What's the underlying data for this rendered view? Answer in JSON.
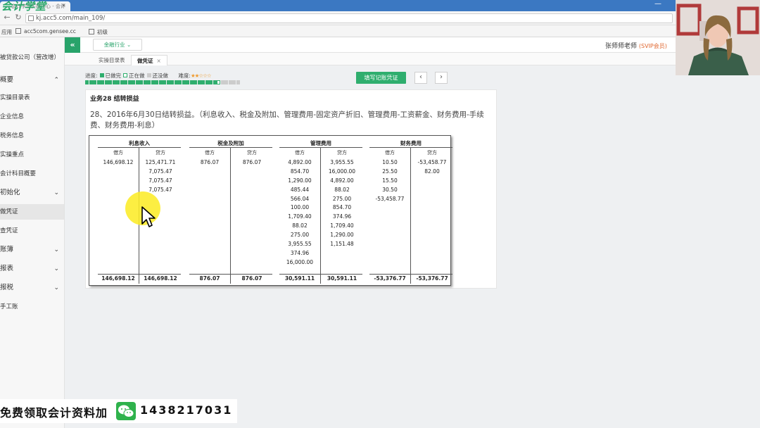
{
  "browser": {
    "tab_logo": "会计学堂",
    "tab_title": "会计学堂实操中心 - 会计",
    "tab_close": "×",
    "url": "kj.acc5.com/main_109/",
    "bookmarks": [
      "应用",
      "acc5com.gensee.cc",
      "初级"
    ]
  },
  "sidebar": {
    "company": "被贷款公司（营改增）",
    "items": [
      {
        "label": "概要",
        "group": true,
        "chevron": "⌃"
      },
      {
        "label": "实操目录表"
      },
      {
        "label": "企业信息"
      },
      {
        "label": "税务信息"
      },
      {
        "label": "实操重点"
      },
      {
        "label": "会计科目概要"
      },
      {
        "label": "初始化",
        "group": true,
        "chevron": "⌄"
      },
      {
        "label": "做凭证",
        "active": true
      },
      {
        "label": "查凭证"
      },
      {
        "label": "账簿",
        "group": true,
        "chevron": "⌄"
      },
      {
        "label": "报表",
        "group": true,
        "chevron": "⌄"
      },
      {
        "label": "报税",
        "group": true,
        "chevron": "⌄"
      },
      {
        "label": "手工账"
      }
    ]
  },
  "topbar": {
    "collapse_icon": "«",
    "industry": "金融行业 ⌄",
    "teacher": "张师师老师",
    "vip": "(SVIP会员)"
  },
  "tabs": [
    {
      "label": "实操目录表"
    },
    {
      "label": "做凭证",
      "close": "×"
    }
  ],
  "progress": {
    "label": "进度:",
    "done": "已做完",
    "doing": "正在做",
    "todo": "还没做",
    "difficulty_label": "难度:",
    "difficulty_stars": "★★☆☆☆",
    "done_color": "#2fae6e",
    "doing_color": "#ffffff",
    "todo_color": "#cccccc",
    "segments_done": 34,
    "segments_total": 40
  },
  "actions": {
    "fill_voucher": "填写记账凭证",
    "prev": "‹",
    "next": "›"
  },
  "business": {
    "title": "业务28 结转损益",
    "question": "28、2016年6月30日结转损益。（利息收入、税金及附加、管理费用-固定资产折旧、管理费用-工资薪金、财务费用-手续费、财务费用-利息）"
  },
  "t_accounts": [
    {
      "name": "利息收入",
      "debit_label": "借方",
      "credit_label": "贷方",
      "debits": [
        "146,698.12"
      ],
      "credits": [
        "125,471.71",
        "7,075.47",
        "7,075.47",
        "7,075.47"
      ],
      "debit_total": "146,698.12",
      "credit_total": "146,698.12"
    },
    {
      "name": "税金及附加",
      "debit_label": "借方",
      "credit_label": "贷方",
      "debits": [
        "876.07"
      ],
      "credits": [
        "876.07"
      ],
      "debit_total": "876.07",
      "credit_total": "876.07"
    },
    {
      "name": "管理费用",
      "debit_label": "借方",
      "credit_label": "贷方",
      "debits": [
        "4,892.00",
        "854.70",
        "1,290.00",
        "485.44",
        "566.04",
        "100.00",
        "1,709.40",
        "88.02",
        "275.00",
        "3,955.55",
        "374.96",
        "16,000.00"
      ],
      "credits": [
        "3,955.55",
        "16,000.00",
        "4,892.00",
        "88.02",
        "275.00",
        "854.70",
        "374.96",
        "1,709.40",
        "1,290.00",
        "1,151.48"
      ],
      "debit_total": "30,591.11",
      "credit_total": "30,591.11"
    },
    {
      "name": "财务费用",
      "debit_label": "借方",
      "credit_label": "贷方",
      "debits": [
        "10.50",
        "25.50",
        "15.50",
        "30.50",
        "-53,458.77"
      ],
      "credits": [
        "-53,458.77",
        "82.00"
      ],
      "debit_total": "-53,376.77",
      "credit_total": "-53,376.77"
    }
  ],
  "ad": {
    "text": "免费领取会计资料加",
    "phone": "1438217031"
  }
}
